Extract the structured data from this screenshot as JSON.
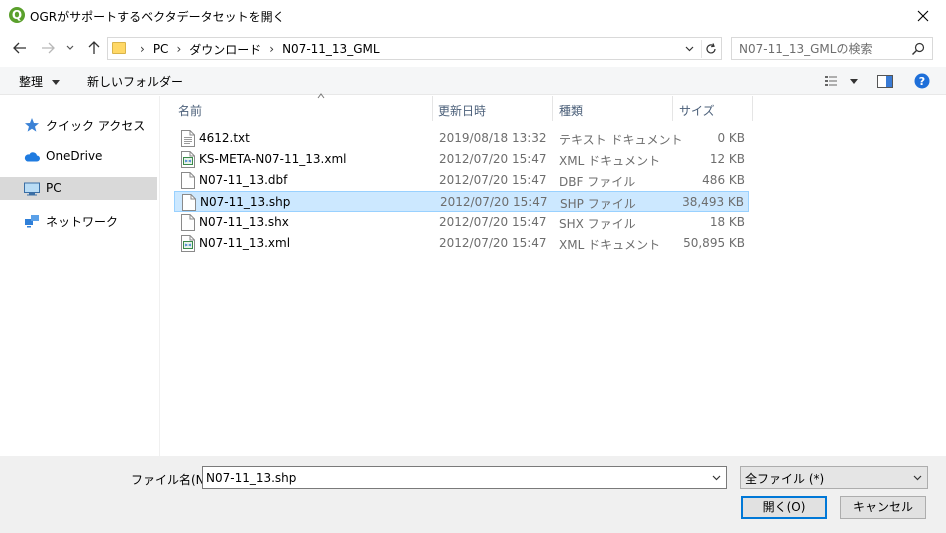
{
  "window": {
    "title": "OGRがサポートするベクタデータセットを開く",
    "app_icon_letter": "Q"
  },
  "address": {
    "crumbs": [
      "PC",
      "ダウンロード",
      "N07-11_13_GML"
    ],
    "search_placeholder": "N07-11_13_GMLの検索"
  },
  "toolbar": {
    "organize_label": "整理",
    "new_folder_label": "新しいフォルダー"
  },
  "nav": {
    "items": [
      {
        "label": "クイック アクセス",
        "icon": "star-icon"
      },
      {
        "label": "OneDrive",
        "icon": "cloud-icon"
      },
      {
        "label": "PC",
        "icon": "computer-icon",
        "selected": true
      },
      {
        "label": "ネットワーク",
        "icon": "network-icon"
      }
    ]
  },
  "columns": {
    "name": "名前",
    "date": "更新日時",
    "type": "種類",
    "size": "サイズ"
  },
  "files": [
    {
      "name": "4612.txt",
      "date": "2019/08/18 13:32",
      "type": "テキスト ドキュメント",
      "size": "0 KB",
      "icon": "text-file-icon"
    },
    {
      "name": "KS-META-N07-11_13.xml",
      "date": "2012/07/20 15:47",
      "type": "XML ドキュメント",
      "size": "12 KB",
      "icon": "xml-file-icon"
    },
    {
      "name": "N07-11_13.dbf",
      "date": "2012/07/20 15:47",
      "type": "DBF ファイル",
      "size": "486 KB",
      "icon": "blank-file-icon"
    },
    {
      "name": "N07-11_13.shp",
      "date": "2012/07/20 15:47",
      "type": "SHP ファイル",
      "size": "38,493 KB",
      "icon": "blank-file-icon",
      "selected": true
    },
    {
      "name": "N07-11_13.shx",
      "date": "2012/07/20 15:47",
      "type": "SHX ファイル",
      "size": "18 KB",
      "icon": "blank-file-icon"
    },
    {
      "name": "N07-11_13.xml",
      "date": "2012/07/20 15:47",
      "type": "XML ドキュメント",
      "size": "50,895 KB",
      "icon": "xml-file-icon"
    }
  ],
  "bottom": {
    "filename_label": "ファイル名(N):",
    "filename_value": "N07-11_13.shp",
    "filetype_value": "全ファイル (*)",
    "open_label": "開く(O)",
    "cancel_label": "キャンセル"
  },
  "colors": {
    "selection": "#cce8ff",
    "nav_selected": "#d9d9d9",
    "accent": "#0078d7",
    "qgis_green": "#5aa02c"
  }
}
